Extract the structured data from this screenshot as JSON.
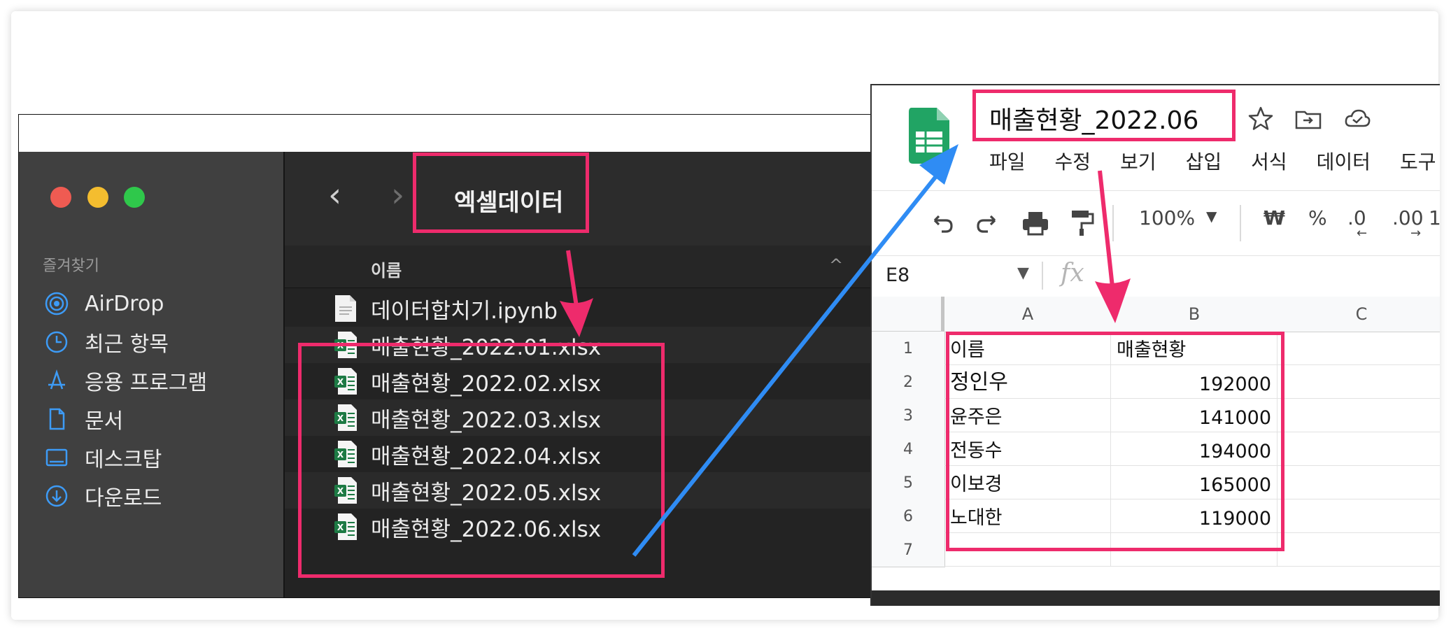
{
  "finder": {
    "folder_title": "엑셀데이터",
    "sidebar_section": "즐겨찾기",
    "sidebar_items": [
      {
        "label": "AirDrop",
        "icon": "airdrop-icon"
      },
      {
        "label": "최근 항목",
        "icon": "clock-icon"
      },
      {
        "label": "응용 프로그램",
        "icon": "apps-icon"
      },
      {
        "label": "문서",
        "icon": "document-icon"
      },
      {
        "label": "데스크탑",
        "icon": "desktop-icon"
      },
      {
        "label": "다운로드",
        "icon": "download-icon"
      }
    ],
    "column_name": "이름",
    "files": [
      {
        "name": "데이터합치기.ipynb",
        "icon": "notebook-file-icon"
      },
      {
        "name": "매출현황_2022.01.xlsx",
        "icon": "excel-file-icon"
      },
      {
        "name": "매출현황_2022.02.xlsx",
        "icon": "excel-file-icon"
      },
      {
        "name": "매출현황_2022.03.xlsx",
        "icon": "excel-file-icon"
      },
      {
        "name": "매출현황_2022.04.xlsx",
        "icon": "excel-file-icon"
      },
      {
        "name": "매출현황_2022.05.xlsx",
        "icon": "excel-file-icon"
      },
      {
        "name": "매출현황_2022.06.xlsx",
        "icon": "excel-file-icon"
      }
    ]
  },
  "sheets": {
    "doc_title": "매출현황_2022.06",
    "menu": [
      "파일",
      "수정",
      "보기",
      "삽입",
      "서식",
      "데이터",
      "도구"
    ],
    "toolbar": {
      "zoom": "100%",
      "currency": "₩",
      "percent": "%",
      "decrease_decimal": ".0",
      "increase_decimal": ".00",
      "more_formats": "1"
    },
    "cell_ref": "E8",
    "fx": "fx",
    "columns": [
      "A",
      "B",
      "C"
    ],
    "rows": [
      "1",
      "2",
      "3",
      "4",
      "5",
      "6",
      "7"
    ],
    "table": [
      [
        "이름",
        "매출현황"
      ],
      [
        "정인우",
        "192000"
      ],
      [
        "윤주은",
        "141000"
      ],
      [
        "전동수",
        "194000"
      ],
      [
        "이보경",
        "165000"
      ],
      [
        "노대한",
        "119000"
      ],
      [
        "",
        ""
      ]
    ]
  },
  "colors": {
    "highlight": "#ee2b6c",
    "arrow_blue": "#2f8cf4",
    "sheets_green": "#21a464"
  }
}
